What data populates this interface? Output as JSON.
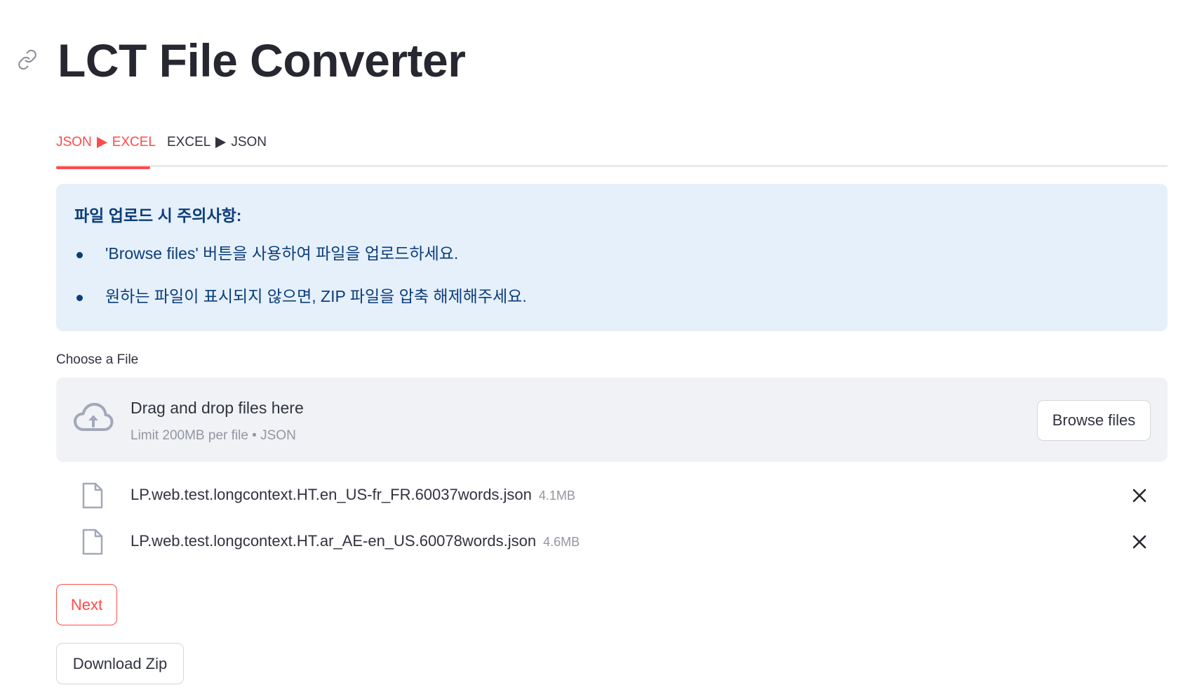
{
  "page": {
    "title": "LCT File Converter",
    "accent_color": "#ff4b4b",
    "info_bg_color": "#e6f0fb",
    "info_text_color": "#0b3d7a"
  },
  "tabs": [
    {
      "left": "JSON",
      "icon": "play-arrow-icon",
      "right": "EXCEL",
      "active": true
    },
    {
      "left": "EXCEL",
      "icon": "play-arrow-icon",
      "right": "JSON",
      "active": false
    }
  ],
  "info": {
    "title": "파일 업로드 시 주의사항:",
    "items": [
      "'Browse files' 버튼을 사용하여 파일을 업로드하세요.",
      "원하는 파일이 표시되지 않으면, ZIP 파일을 압축 해제해주세요."
    ]
  },
  "uploader": {
    "label": "Choose a File",
    "icon": "cloud-upload-icon",
    "drop_text": "Drag and drop files here",
    "limit_text": "Limit 200MB per file • JSON",
    "browse_label": "Browse files"
  },
  "files": [
    {
      "name": "LP.web.test.longcontext.HT.en_US-fr_FR.60037words.json",
      "size": "4.1MB"
    },
    {
      "name": "LP.web.test.longcontext.HT.ar_AE-en_US.60078words.json",
      "size": "4.6MB"
    }
  ],
  "buttons": {
    "next": "Next",
    "download_zip": "Download Zip"
  }
}
